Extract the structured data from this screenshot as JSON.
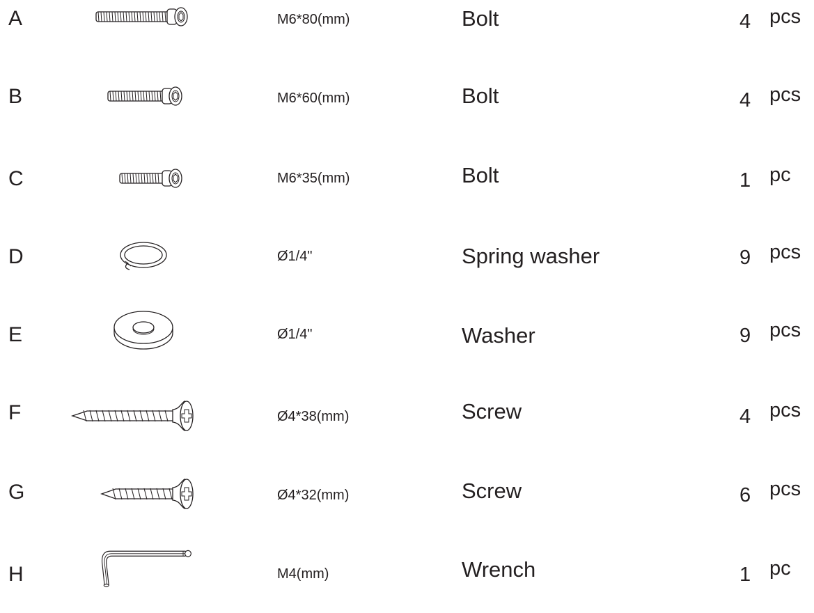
{
  "parts": [
    {
      "letter": "A",
      "icon": "bolt-long-icon",
      "spec": "M6*80(mm)",
      "name": "Bolt",
      "qty": "4",
      "unit": "pcs"
    },
    {
      "letter": "B",
      "icon": "bolt-medium-icon",
      "spec": "M6*60(mm)",
      "name": "Bolt",
      "qty": "4",
      "unit": "pcs"
    },
    {
      "letter": "C",
      "icon": "bolt-short-icon",
      "spec": "M6*35(mm)",
      "name": "Bolt",
      "qty": "1",
      "unit": "pc"
    },
    {
      "letter": "D",
      "icon": "spring-washer-icon",
      "spec": "Ø1/4\"",
      "name": "Spring washer",
      "qty": "9",
      "unit": "pcs"
    },
    {
      "letter": "E",
      "icon": "flat-washer-icon",
      "spec": "Ø1/4\"",
      "name": "Washer",
      "qty": "9",
      "unit": "pcs"
    },
    {
      "letter": "F",
      "icon": "screw-long-icon",
      "spec": "Ø4*38(mm)",
      "name": "Screw",
      "qty": "4",
      "unit": "pcs"
    },
    {
      "letter": "G",
      "icon": "screw-short-icon",
      "spec": "Ø4*32(mm)",
      "name": "Screw",
      "qty": "6",
      "unit": "pcs"
    },
    {
      "letter": "H",
      "icon": "hex-wrench-icon",
      "spec": "M4(mm)",
      "name": "Wrench",
      "qty": "1",
      "unit": "pc"
    }
  ]
}
